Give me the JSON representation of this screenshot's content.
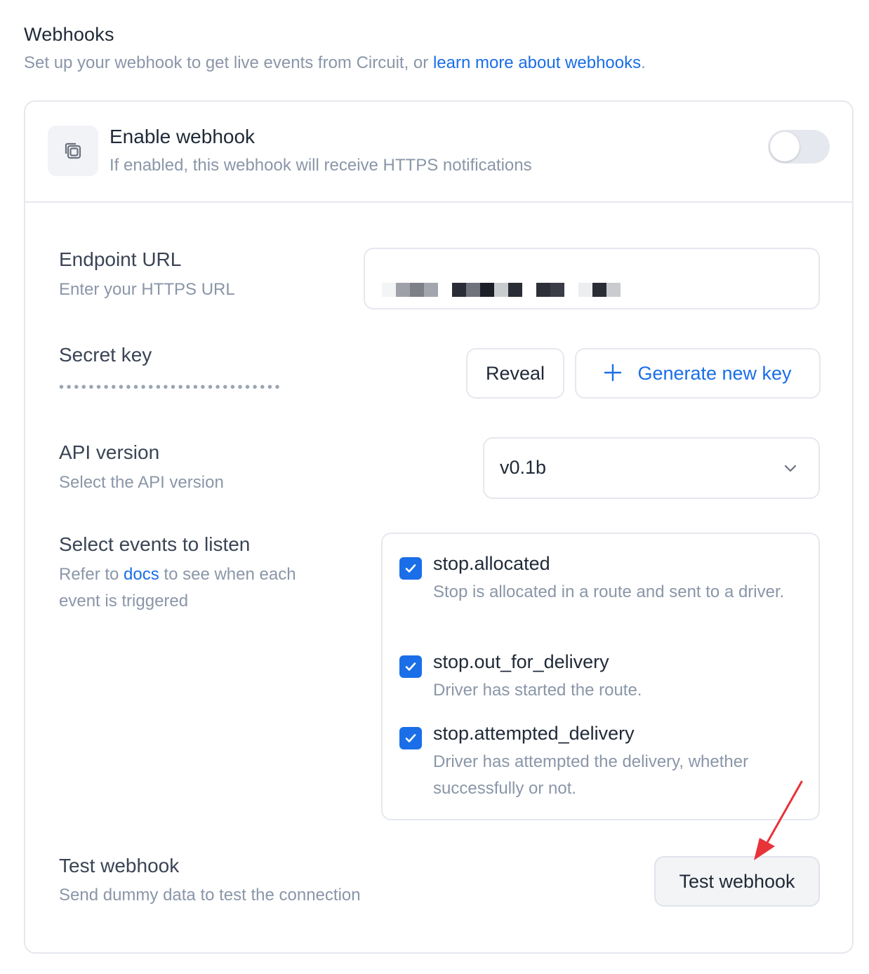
{
  "header": {
    "title": "Webhooks",
    "subtitle_prefix": "Set up your webhook to get live events from Circuit, or ",
    "subtitle_link": "learn more about webhooks",
    "subtitle_suffix": "."
  },
  "enable": {
    "icon": "copy-icon",
    "title": "Enable webhook",
    "description": "If enabled, this webhook will receive HTTPS notifications",
    "toggle_on": false
  },
  "endpoint": {
    "title": "Endpoint URL",
    "description": "Enter your HTTPS URL",
    "value_redacted": true
  },
  "secret": {
    "title": "Secret key",
    "masked_value": "••••••••••••••••••••••••••••••",
    "reveal_label": "Reveal",
    "generate_label": "Generate new key",
    "generate_icon": "plus-icon"
  },
  "api_version": {
    "title": "API version",
    "description": "Select the API version",
    "selected": "v0.1b",
    "icon": "chevron-down-icon"
  },
  "events": {
    "title": "Select events to listen",
    "desc_prefix": "Refer to ",
    "desc_link": "docs",
    "desc_suffix": " to see when each event is triggered",
    "items": [
      {
        "name": "stop.allocated",
        "description": "Stop is allocated in a route and sent to a driver.",
        "checked": true
      },
      {
        "name": "stop.out_for_delivery",
        "description": "Driver has started the route.",
        "checked": true
      },
      {
        "name": "stop.attempted_delivery",
        "description": "Driver has attempted the delivery, whether successfully or not.",
        "checked": true
      }
    ]
  },
  "test": {
    "title": "Test webhook",
    "description": "Send dummy data to test the connection",
    "button_label": "Test webhook"
  },
  "colors": {
    "accent": "#1a6ee8",
    "muted_text": "#8a96a8",
    "border": "#e5e8ee",
    "annotation_arrow": "#e8333a"
  }
}
